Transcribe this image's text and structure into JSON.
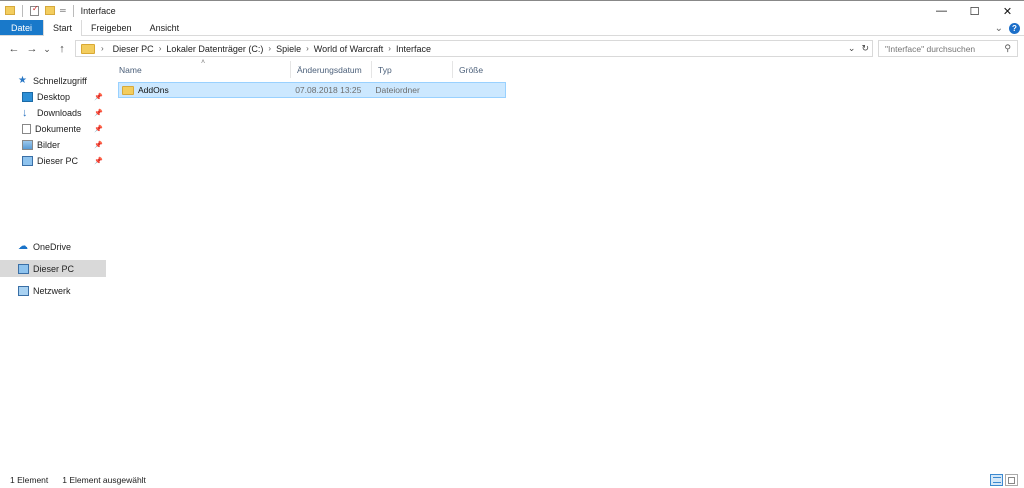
{
  "window": {
    "title": "Interface",
    "minimize_glyph": "—",
    "maximize_glyph": "☐",
    "close_glyph": "✕"
  },
  "ribbon": {
    "tabs": [
      {
        "label": "Datei"
      },
      {
        "label": "Start"
      },
      {
        "label": "Freigeben"
      },
      {
        "label": "Ansicht"
      }
    ],
    "help_label": "?",
    "expand_glyph": "⌄"
  },
  "nav": {
    "back_glyph": "←",
    "forward_glyph": "→",
    "recent_glyph": "⌄",
    "up_glyph": "↑",
    "breadcrumb": [
      "Dieser PC",
      "Lokaler Datenträger (C:)",
      "Spiele",
      "World of Warcraft",
      "Interface"
    ],
    "crumb_separator": "›",
    "dropdown_glyph": "⌄",
    "refresh_glyph": "↻"
  },
  "search": {
    "placeholder": "\"Interface\" durchsuchen",
    "icon": "magnifier"
  },
  "sidebar": {
    "items": [
      {
        "label": "Schnellzugriff",
        "icon": "star-icon",
        "pinned": false
      },
      {
        "label": "Desktop",
        "icon": "desktop-icon",
        "pinned": true
      },
      {
        "label": "Downloads",
        "icon": "download-icon",
        "pinned": true
      },
      {
        "label": "Dokumente",
        "icon": "document-icon",
        "pinned": true
      },
      {
        "label": "Bilder",
        "icon": "pictures-icon",
        "pinned": true
      },
      {
        "label": "Dieser PC",
        "icon": "monitor-icon",
        "pinned": true
      },
      {
        "label": "OneDrive",
        "icon": "cloud-icon",
        "pinned": false
      },
      {
        "label": "Dieser PC",
        "icon": "monitor-icon",
        "pinned": false,
        "selected": true
      },
      {
        "label": "Netzwerk",
        "icon": "network-icon",
        "pinned": false
      }
    ],
    "pin_glyph": "📌"
  },
  "filelist": {
    "columns": [
      "Name",
      "Änderungsdatum",
      "Typ",
      "Größe"
    ],
    "sort_glyph": "˄",
    "rows": [
      {
        "name": "AddOns",
        "date": "07.08.2018 13:25",
        "type": "Dateiordner",
        "size": "",
        "selected": true
      }
    ]
  },
  "status": {
    "count": "1 Element",
    "selection": "1 Element ausgewählt"
  },
  "colors": {
    "accent": "#1979ca",
    "selection_bg": "#cce8ff",
    "selection_border": "#99d1ff",
    "folder": "#f3cd5e"
  }
}
